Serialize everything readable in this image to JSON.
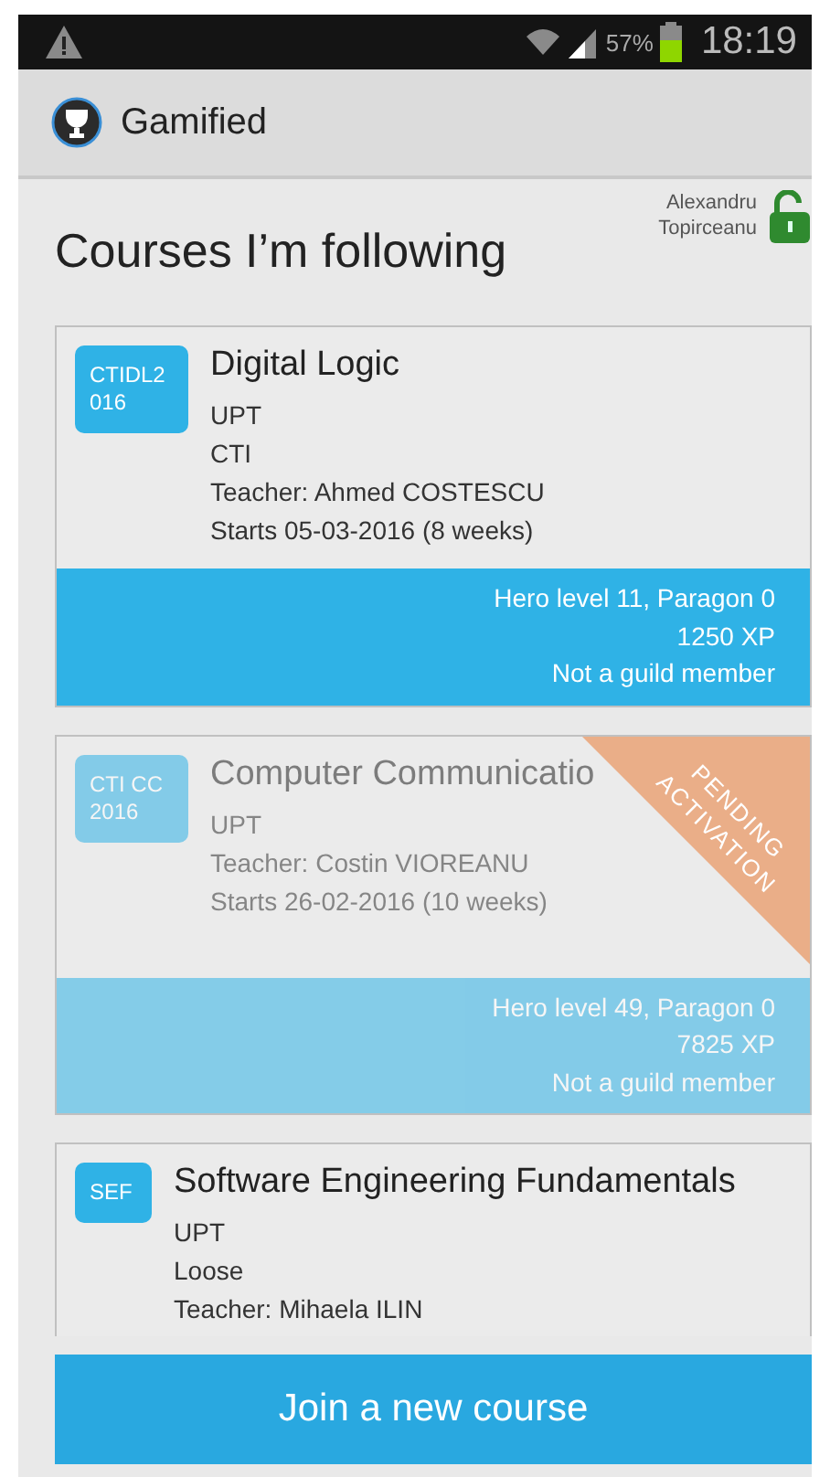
{
  "status_bar": {
    "battery_percent": "57%",
    "time": "18:19"
  },
  "app_bar": {
    "title": "Gamified"
  },
  "header": {
    "title": "Courses I’m following",
    "user": "Alexandru Topirceanu",
    "logged_in": true
  },
  "courses": [
    {
      "code": "CTIDL2016",
      "title": "Digital Logic",
      "lines": [
        "UPT",
        "CTI",
        "Teacher: Ahmed COSTESCU",
        "Starts 05-03-2016 (8 weeks)"
      ],
      "pending": false,
      "stats": [
        "Hero level 11, Paragon 0",
        "1250 XP",
        "Not a guild member"
      ]
    },
    {
      "code": "CTI CC 2016",
      "title": "Computer Communicatio",
      "lines": [
        "UPT",
        "Teacher: Costin VIOREANU",
        "Starts 26-02-2016 (10 weeks)"
      ],
      "pending": true,
      "ribbon": "PENDING ACTIVATION",
      "stats": [
        "Hero level 49, Paragon 0",
        "7825 XP",
        "Not a guild member"
      ]
    },
    {
      "code": "SEF",
      "title": "Software Engineering Fundamentals",
      "lines": [
        "UPT",
        "Loose",
        "Teacher: Mihaela ILIN"
      ],
      "pending": false
    }
  ],
  "join_button": "Join a new course"
}
